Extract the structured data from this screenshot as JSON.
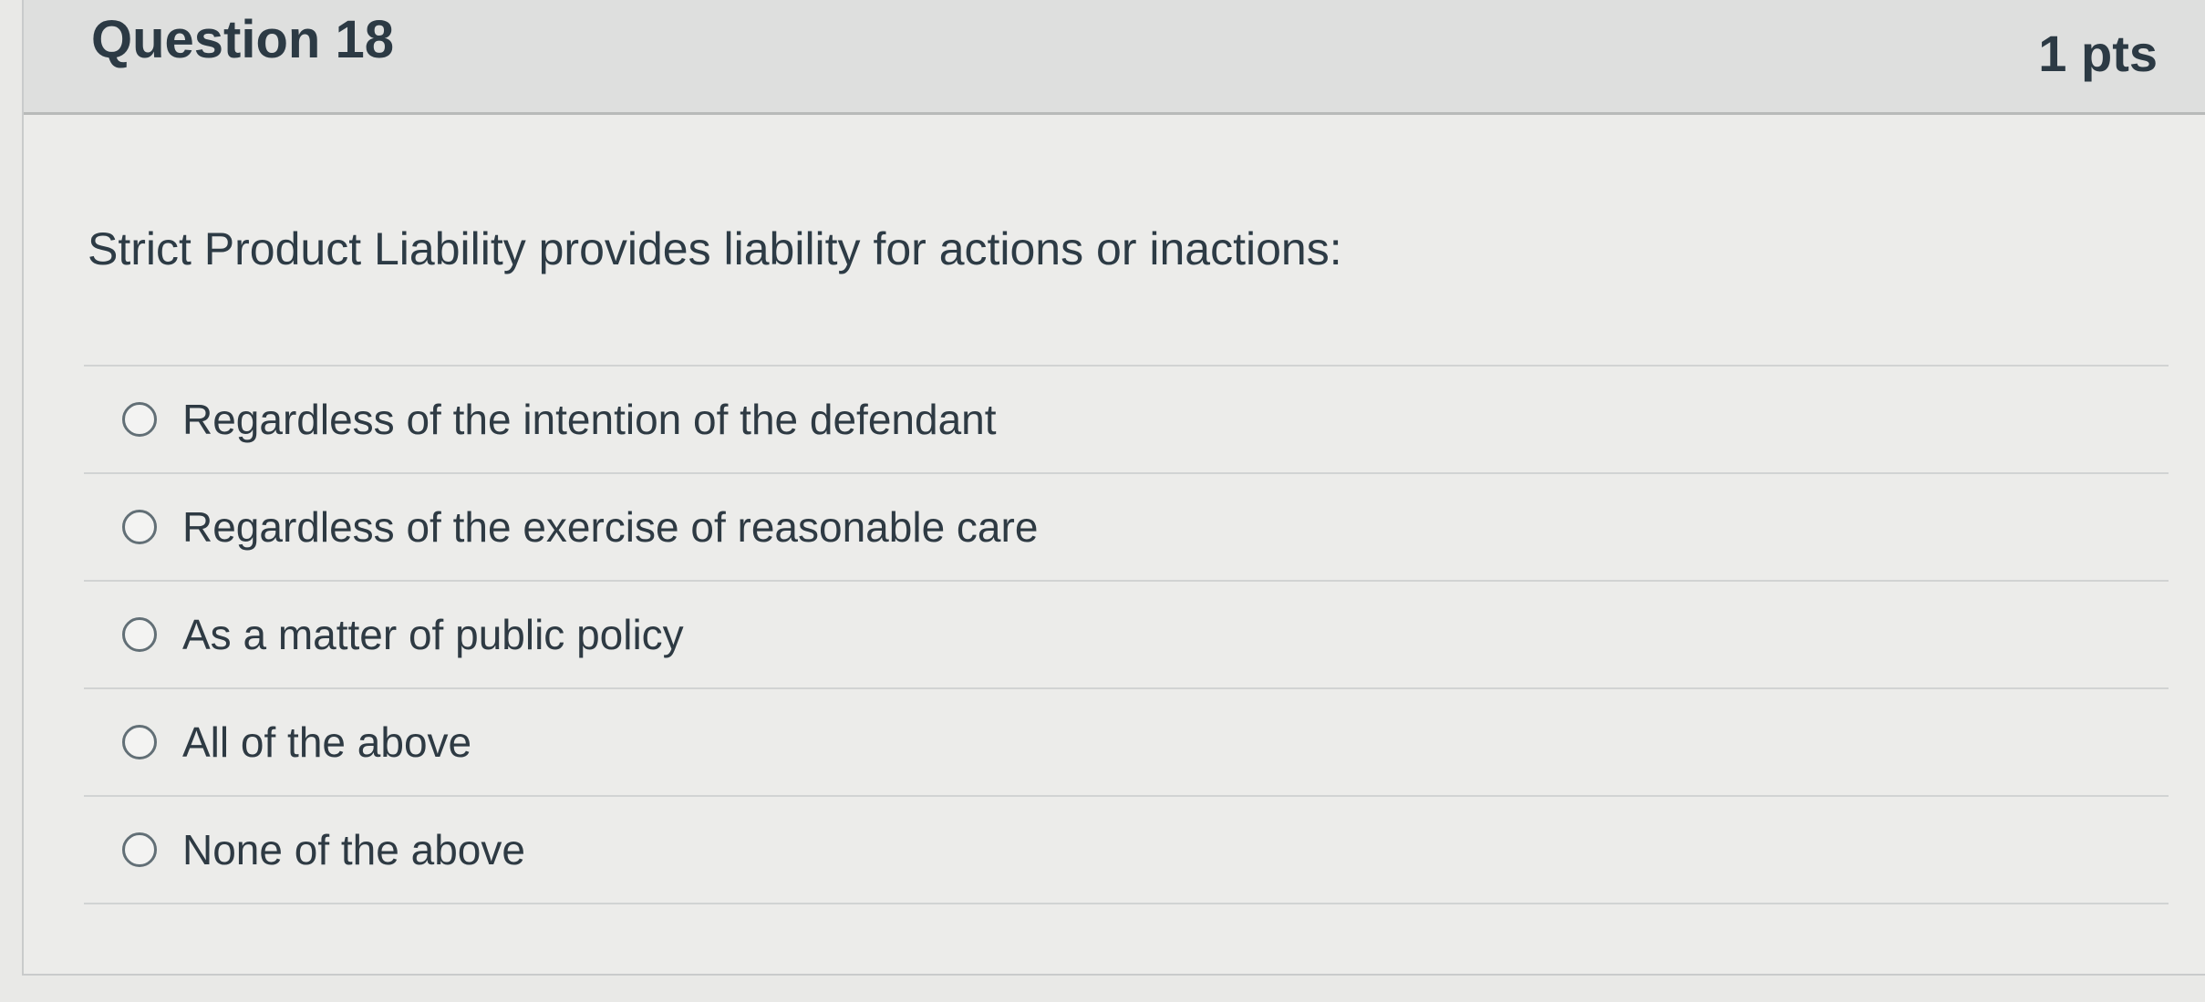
{
  "question": {
    "title": "Question 18",
    "points": "1 pts",
    "text": "Strict Product Liability provides liability for actions or inactions:"
  },
  "answers": [
    {
      "label": "Regardless of the intention of the defendant",
      "selected": false
    },
    {
      "label": "Regardless of the exercise of reasonable care",
      "selected": false
    },
    {
      "label": "As a matter of public policy",
      "selected": false
    },
    {
      "label": "All of the above",
      "selected": false
    },
    {
      "label": "None of the above",
      "selected": false
    }
  ],
  "colors": {
    "background": "#ececea",
    "header_background": "#dedfde",
    "text": "#2d3b45",
    "divider": "#d1d3d3",
    "radio_border": "#626f76"
  },
  "icons": {
    "radio": "radio-button-unselected"
  }
}
